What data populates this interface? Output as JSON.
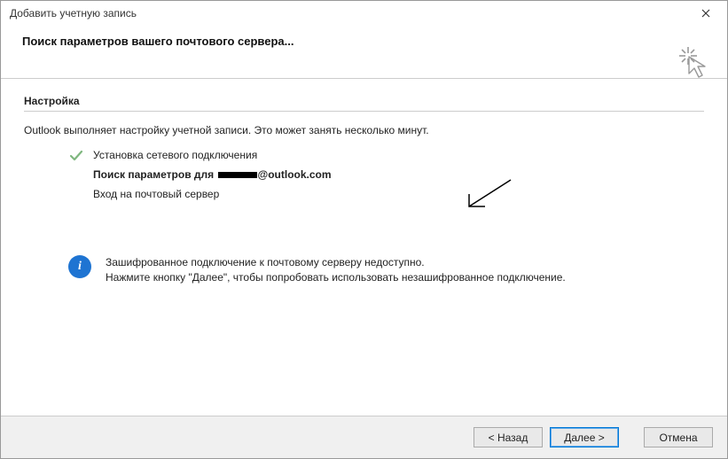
{
  "window": {
    "title": "Добавить учетную запись"
  },
  "header": {
    "heading": "Поиск параметров вашего почтового сервера..."
  },
  "setup": {
    "section_title": "Настройка",
    "intro": "Outlook выполняет настройку учетной записи. Это может занять несколько минут.",
    "steps": {
      "network": "Установка сетевого подключения",
      "search_prefix": "Поиск параметров для",
      "search_domain": "@outlook.com",
      "login": "Вход на почтовый сервер"
    }
  },
  "info": {
    "line1": "Зашифрованное подключение к почтовому серверу недоступно.",
    "line2": "Нажмите кнопку \"Далее\", чтобы попробовать использовать незашифрованное подключение."
  },
  "buttons": {
    "back": "< Назад",
    "next": "Далее >",
    "cancel": "Отмена"
  }
}
